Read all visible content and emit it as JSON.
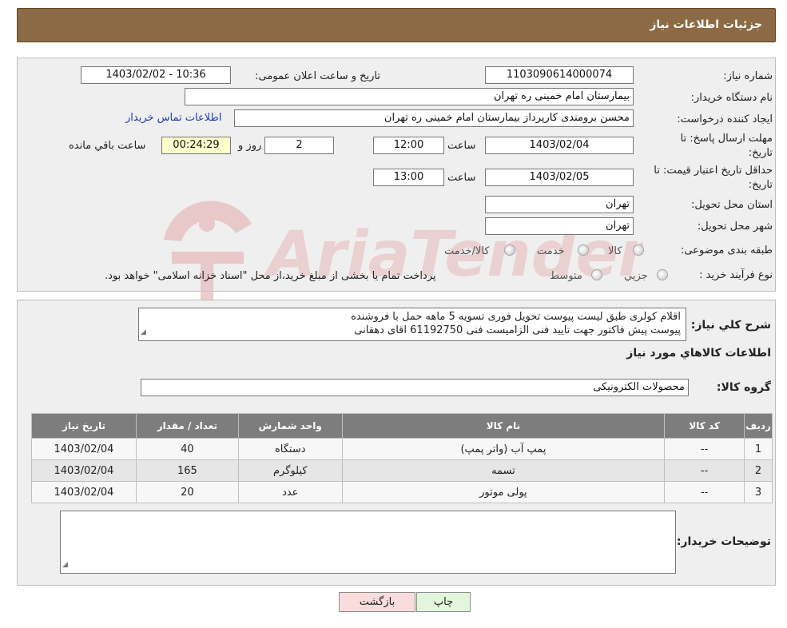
{
  "header": {
    "title": "جزئیات اطلاعات نیاز"
  },
  "form": {
    "need_number_label": "شماره نیاز:",
    "need_number": "1103090614000074",
    "announce_label": "تاریخ و ساعت اعلان عمومی:",
    "announce_value": "1403/02/02 - 10:36",
    "buyer_label": "نام دستگاه خریدار:",
    "buyer_value": "بیمارستان امام خمینی ره  تهران",
    "creator_label": "ایجاد کننده درخواست:",
    "creator_value": "محسن برومندی کارپرداز بیمارستان امام خمینی ره  تهران",
    "contact_link": "اطلاعات تماس خریدار",
    "deadline_label_line1": "مهلت ارسال پاسخ: تا",
    "deadline_label_line2": "تاریخ:",
    "deadline_date": "1403/02/04",
    "time_label": "ساعت",
    "deadline_time": "12:00",
    "days_value": "2",
    "days_label": "روز و",
    "remaining_time": "00:24:29",
    "remaining_label": "ساعت باقي مانده",
    "validity_label_line1": "حداقل تاریخ اعتبار قیمت: تا",
    "validity_label_line2": "تاریخ:",
    "validity_date": "1403/02/05",
    "validity_time": "13:00",
    "province_label": "استان محل تحویل:",
    "province_value": "تهران",
    "city_label": "شهر محل تحویل:",
    "city_value": "تهران",
    "category_label": "طبقه بندی موضوعی:",
    "category_options": [
      "کالا",
      "خدمت",
      "کالا/خدمت"
    ],
    "process_label": "نوع فرآیند خرید :",
    "process_options": [
      "جزیي",
      "متوسط"
    ],
    "process_note": "پرداخت تمام یا بخشی از مبلغ خرید،از محل \"اسناد خزانه اسلامی\" خواهد بود."
  },
  "description": {
    "label": "شرح کلي نياز:",
    "line1": "اقلام کولری طبق لیست پیوست تحویل فوری تسویه 5 ماهه حمل با فروشنده",
    "line2": "پیوست پیش فاکتور جهت تایید فنی الزامیست فنی 61192750 اقای دهقانی"
  },
  "goods_section": {
    "title": "اطلاعات کالاهاي مورد نياز",
    "group_label": "گروه کالا:",
    "group_value": "محصولات الکترونیکی"
  },
  "table": {
    "headers": [
      "ردیف",
      "کد کالا",
      "نام کالا",
      "واحد شمارش",
      "تعداد / مقدار",
      "تاریخ نیاز"
    ],
    "rows": [
      [
        "1",
        "--",
        "پمپ آب (واتر پمپ)",
        "دستگاه",
        "40",
        "1403/02/04"
      ],
      [
        "2",
        "--",
        "تسمه",
        "کیلوگرم",
        "165",
        "1403/02/04"
      ],
      [
        "3",
        "--",
        "پولی موتور",
        "عدد",
        "20",
        "1403/02/04"
      ]
    ]
  },
  "buyer_notes": {
    "label": "توضیحات خریدار:",
    "value": ""
  },
  "buttons": {
    "back": "بازگشت",
    "print": "چاپ"
  },
  "watermark": {
    "text": "AriaTender.neT"
  },
  "colors": {
    "header": "#8b6a45",
    "table_header": "#7d7d7d",
    "link": "#1a3fb0",
    "watermark": "#e6bcbc"
  }
}
